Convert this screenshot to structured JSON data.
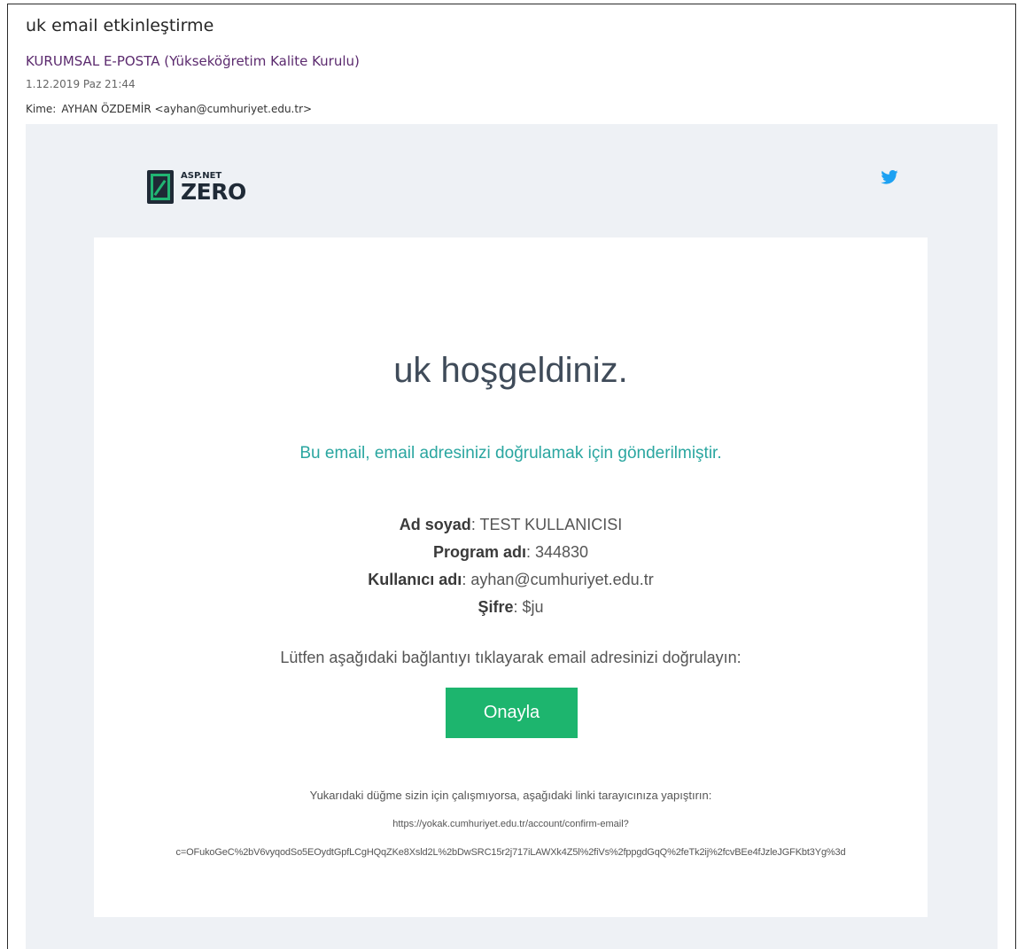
{
  "header": {
    "subject": "uk email etkinleştirme",
    "sender": "KURUMSAL E-POSTA (Yükseköğretim Kalite Kurulu)",
    "date": "1.12.2019 Paz 21:44",
    "to_label": "Kime:",
    "to_value": "AYHAN ÖZDEMİR <ayhan@cumhuriyet.edu.tr>"
  },
  "logo": {
    "small": "ASP.NET",
    "big": "ZERO"
  },
  "icons": {
    "twitter": "twitter-icon"
  },
  "body": {
    "welcome": "uk hoşgeldiniz.",
    "info": "Bu email, email adresinizi doğrulamak için gönderilmiştir.",
    "details": [
      {
        "label": "Ad soyad",
        "value": ": TEST KULLANICISI"
      },
      {
        "label": "Program adı",
        "value": ": 344830"
      },
      {
        "label": "Kullanıcı adı",
        "value": ": ayhan@cumhuriyet.edu.tr"
      },
      {
        "label": "Şifre",
        "value": ": $ju"
      }
    ],
    "instruction": "Lütfen aşağıdaki bağlantıyı tıklayarak email adresinizi doğrulayın:",
    "button_label": "Onayla",
    "fallback": "Yukarıdaki düğme sizin için çalışmıyorsa, aşağıdaki linki tarayıcınıza yapıştırın:",
    "link_line1": "https://yokak.cumhuriyet.edu.tr/account/confirm-email?",
    "link_line2": "c=OFukoGeC%2bV6vyqodSo5EOydtGpfLCgHQqZKe8Xsld2L%2bDwSRC15r2j717iLAWXk4Z5l%2fiVs%2fppgdGqQ%2feTk2ij%2fcvBEe4fJzleJGFKbt3Yg%3d"
  },
  "colors": {
    "accent_green": "#1db56e",
    "info_teal": "#2aa6a0",
    "sender_purple": "#5b2a6e",
    "background": "#eef1f5",
    "twitter_blue": "#1da1f2"
  }
}
